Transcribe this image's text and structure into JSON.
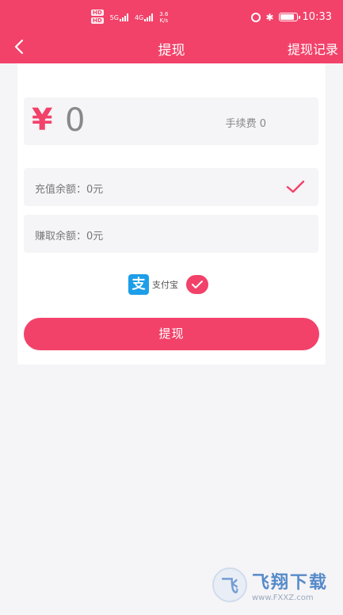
{
  "colors": {
    "accent": "#f2426a",
    "background": "#f5f4f6",
    "alipay_blue": "#1d9ee8"
  },
  "status_bar": {
    "hd1": "HD",
    "hd2": "HD",
    "net1": "5G",
    "net2": "4G",
    "speed_value": "3.6",
    "speed_unit": "K/s",
    "time": "10:33"
  },
  "nav": {
    "back_icon": "chevron-left-icon",
    "title": "提现",
    "right_link": "提现记录"
  },
  "amount": {
    "currency_symbol": "¥",
    "value": "0",
    "fee": "手续费 0"
  },
  "balances": {
    "recharge": "充值余额：0元",
    "earned": "赚取余额：0元"
  },
  "payment": {
    "logo_char": "支",
    "name": "支付宝"
  },
  "submit_label": "提现",
  "watermark": {
    "logo_char": "飞",
    "text_cn": "飞翔下载",
    "text_en": "www.FXXZ.com"
  }
}
